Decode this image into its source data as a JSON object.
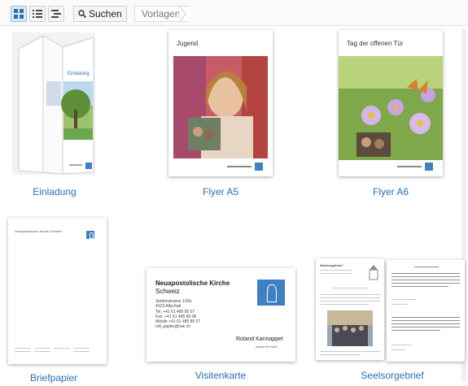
{
  "toolbar": {
    "view_buttons": [
      "grid-view",
      "list-view",
      "tree-view"
    ],
    "search_label": "Suchen",
    "breadcrumb": "Vorlagen"
  },
  "templates": [
    {
      "label": "Einladung",
      "cover_text": "Einladung"
    },
    {
      "label": "Flyer A5",
      "cover_text": "Jugend"
    },
    {
      "label": "Flyer A6",
      "cover_text": "Tag der offenen Tür"
    },
    {
      "label": "Briefpapier",
      "cover_text": "Neuapostolische Kirche Schweiz"
    },
    {
      "label": "Visitenkarte",
      "card": {
        "org": "Neuapostolische Kirche",
        "org_sub": "Schweiz",
        "address": [
          "Seidenstrasse 103a",
          "4123 Allschwil",
          "Tel.    +41 61 485 85 07",
          "Fax.   +41 61 485 85 08",
          "Mobile +41 61 485 85 07",
          "roll_papke@nak.ch"
        ],
        "name": "Roland Kannappel",
        "role": "Admin für NAK"
      }
    },
    {
      "label": "Seelsorgebrief",
      "cover_text": "Seelsorgebrief"
    }
  ],
  "colors": {
    "accent": "#2a6fb3",
    "logo_blue": "#3f7fc3"
  }
}
